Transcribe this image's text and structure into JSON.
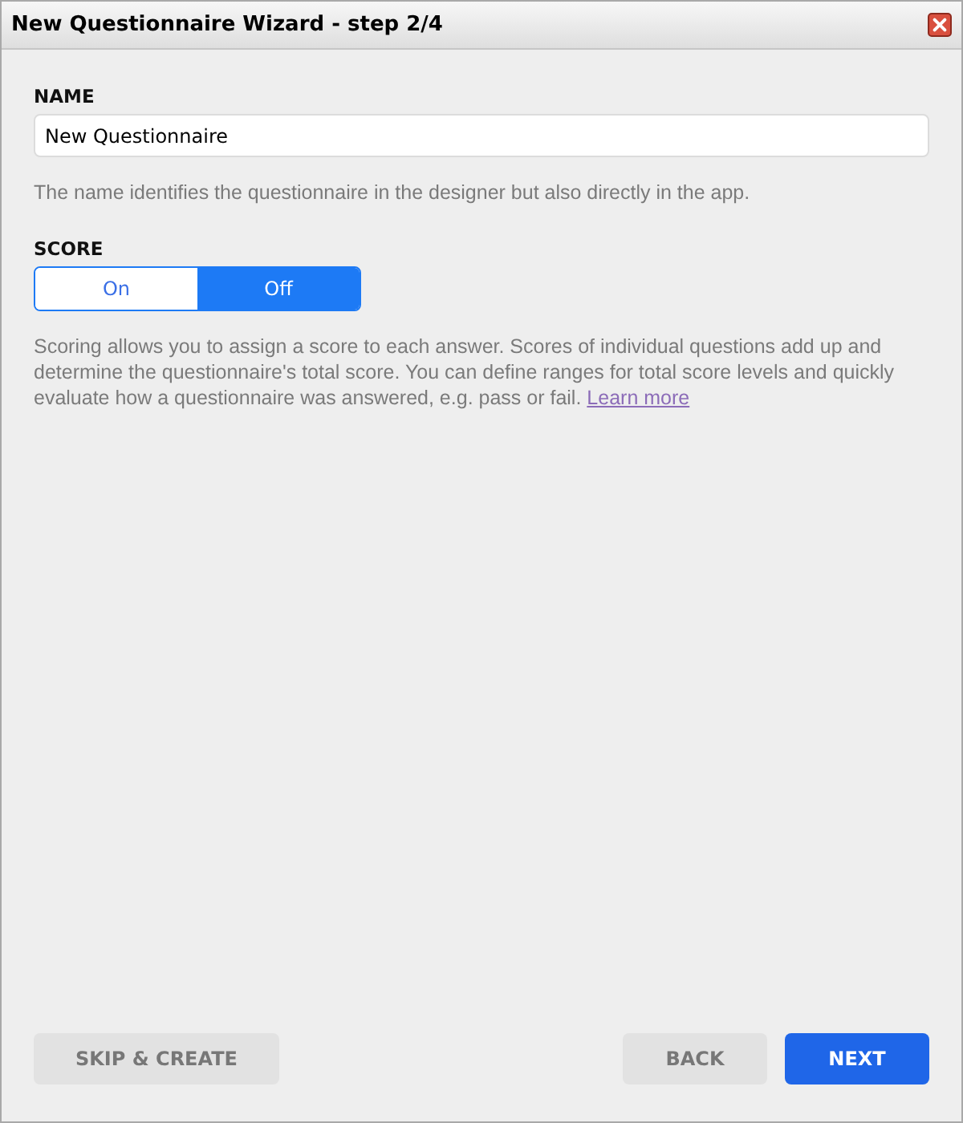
{
  "window": {
    "title": "New Questionnaire Wizard - step 2/4"
  },
  "name_field": {
    "label": "NAME",
    "value": "New Questionnaire",
    "hint": "The name identifies the questionnaire in the designer but also directly in the app."
  },
  "score": {
    "label": "SCORE",
    "options": [
      {
        "label": "On",
        "selected": false
      },
      {
        "label": "Off",
        "selected": true
      }
    ],
    "description": "Scoring allows you to assign a score to each answer. Scores of individual questions add up and determine the questionnaire's total score. You can define ranges for total score levels and quickly evaluate how a questionnaire was answered, e.g. pass or fail.",
    "link": "Learn more"
  },
  "footer": {
    "left": [
      {
        "label": "SKIP & CREATE",
        "kind": "secondary"
      }
    ],
    "right": [
      {
        "label": "BACK",
        "kind": "secondary"
      },
      {
        "label": "NEXT",
        "kind": "primary"
      }
    ]
  }
}
